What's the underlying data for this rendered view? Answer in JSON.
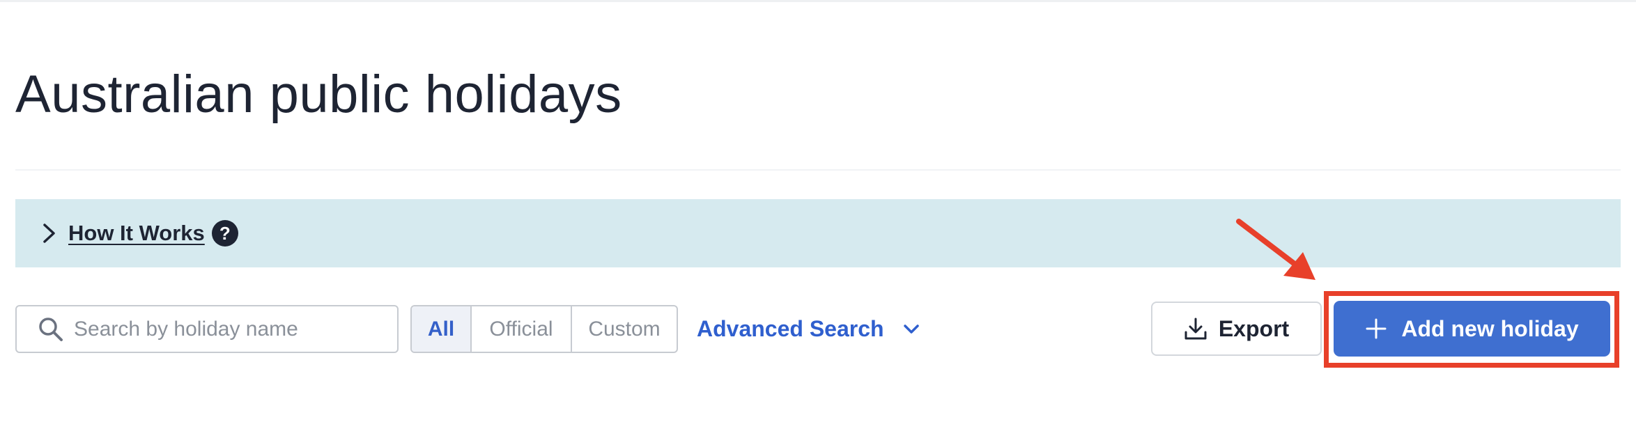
{
  "page": {
    "title": "Australian public holidays"
  },
  "banner": {
    "label": "How It Works",
    "help_icon": "?",
    "chevron_icon": "chevron-right-icon"
  },
  "search": {
    "placeholder": "Search by holiday name",
    "value": "",
    "icon": "search-icon"
  },
  "filter": {
    "options": [
      "All",
      "Official",
      "Custom"
    ],
    "selected": "All"
  },
  "advanced_search": {
    "label": "Advanced Search",
    "icon": "chevron-down-icon"
  },
  "actions": {
    "export_label": "Export",
    "export_icon": "download-icon",
    "add_label": "Add new holiday",
    "add_icon": "plus-icon"
  },
  "annotation": {
    "highlight_color": "#e8402a",
    "arrow_color": "#e8402a"
  },
  "colors": {
    "accent": "#3f6fd0",
    "link": "#2f5fce",
    "banner_bg": "#d6eaef",
    "title": "#1e2433"
  }
}
